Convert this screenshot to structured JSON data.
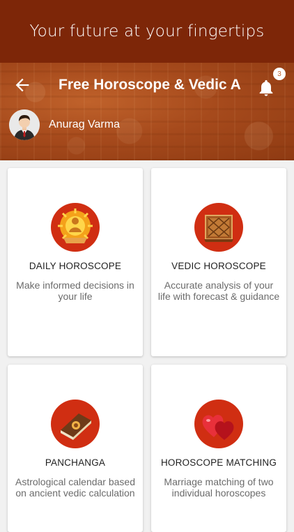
{
  "banner": {
    "text": "Your future at your fingertips"
  },
  "header": {
    "title": "Free Horoscope & Vedic A",
    "notification_count": "3",
    "user_name": "Anurag Varma"
  },
  "cards": [
    {
      "title": "DAILY HOROSCOPE",
      "description": "Make informed decisions in your life"
    },
    {
      "title": "VEDIC HOROSCOPE",
      "description": "Accurate analysis of your life with forecast & guidance"
    },
    {
      "title": "PANCHANGA",
      "description": "Astrological calendar based on ancient vedic calculation"
    },
    {
      "title": "HOROSCOPE MATCHING",
      "description": "Marriage matching of two individual horoscopes"
    }
  ],
  "colors": {
    "banner": "#7d2608",
    "header": "#a64a1c",
    "icon_circle": "#d02e12"
  }
}
